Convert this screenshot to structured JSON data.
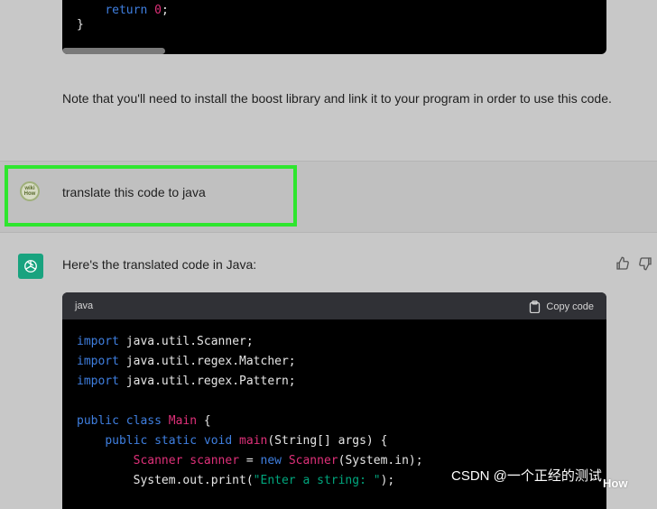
{
  "previous_code": {
    "line_return_keyword": "return",
    "line_return_value": "0",
    "line_close": "}"
  },
  "note": "Note that you'll need to install the boost library and link it to your program in order to use this code.",
  "user": {
    "avatar_text": "wiki How",
    "message": "translate this code to java"
  },
  "assistant": {
    "intro": "Here's the translated code in Java:"
  },
  "code_block": {
    "language": "java",
    "copy_label": "Copy code"
  },
  "watermarks": {
    "csdn": "CSDN @一个正经的测试",
    "wikihow": "How"
  },
  "colors": {
    "highlight": "#2ee62e",
    "assistant_avatar": "#19a37f",
    "code_bg": "#000000",
    "code_header_bg": "#303136"
  }
}
